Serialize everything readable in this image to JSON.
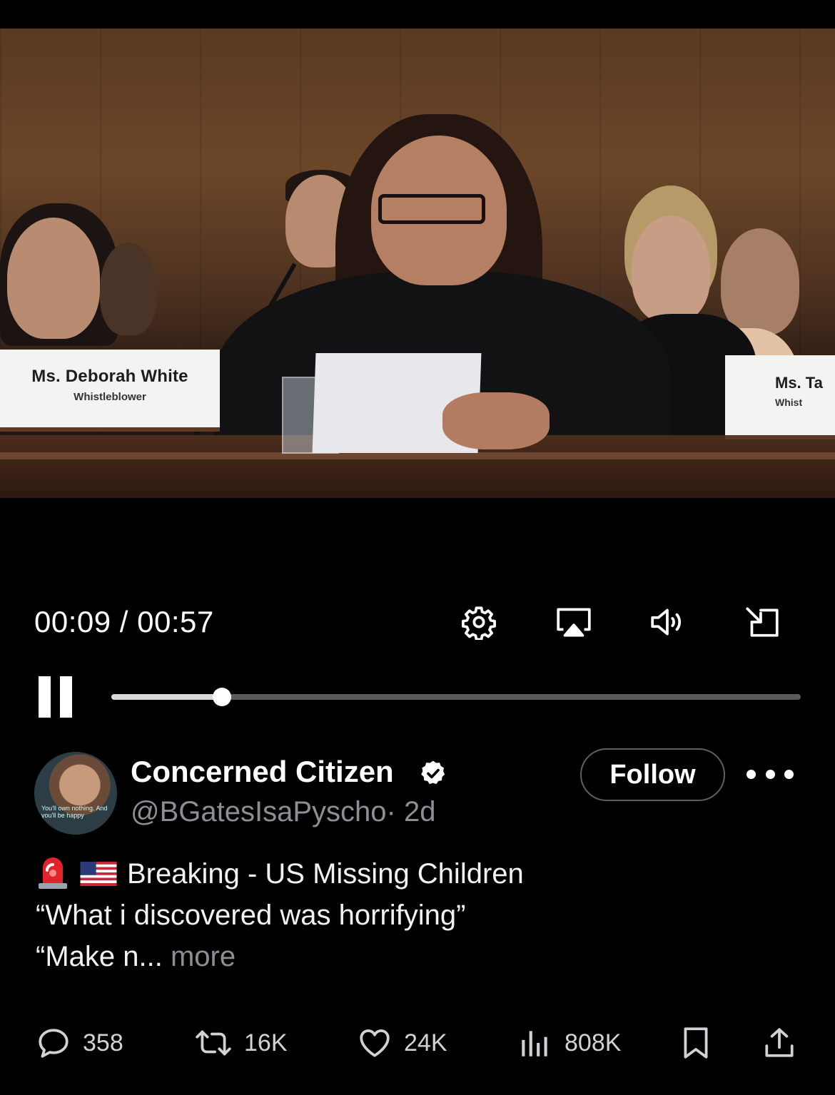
{
  "video": {
    "nameplate_left": {
      "name": "Ms. Deborah White",
      "title": "Whistleblower"
    },
    "nameplate_right": {
      "name": "Ms. Ta",
      "title": "Whist"
    }
  },
  "player": {
    "current_time": "00:09",
    "duration": "00:57",
    "time_display": "00:09 / 00:57",
    "progress_fraction": 0.16,
    "icons": [
      "settings-gear-icon",
      "airplay-icon",
      "volume-icon",
      "exit-fullscreen-icon",
      "pause-icon"
    ]
  },
  "post": {
    "display_name": "Concerned Citizen",
    "verified": true,
    "handle": "@BGatesIsaPyscho",
    "age": "· 2d",
    "follow_label": "Follow",
    "avatar_text": "You'll own nothing. And you'll be happy",
    "text_line1": "Breaking - US Missing Children",
    "text_line2": "“What i discovered was horrifying”",
    "text_line3": "“Make n...",
    "more_label": "more"
  },
  "actions": {
    "replies": "358",
    "reposts": "16K",
    "likes": "24K",
    "views": "808K"
  },
  "colors": {
    "background": "#000000",
    "secondary_text": "#8b8f94",
    "track": "#5a5a5a"
  }
}
